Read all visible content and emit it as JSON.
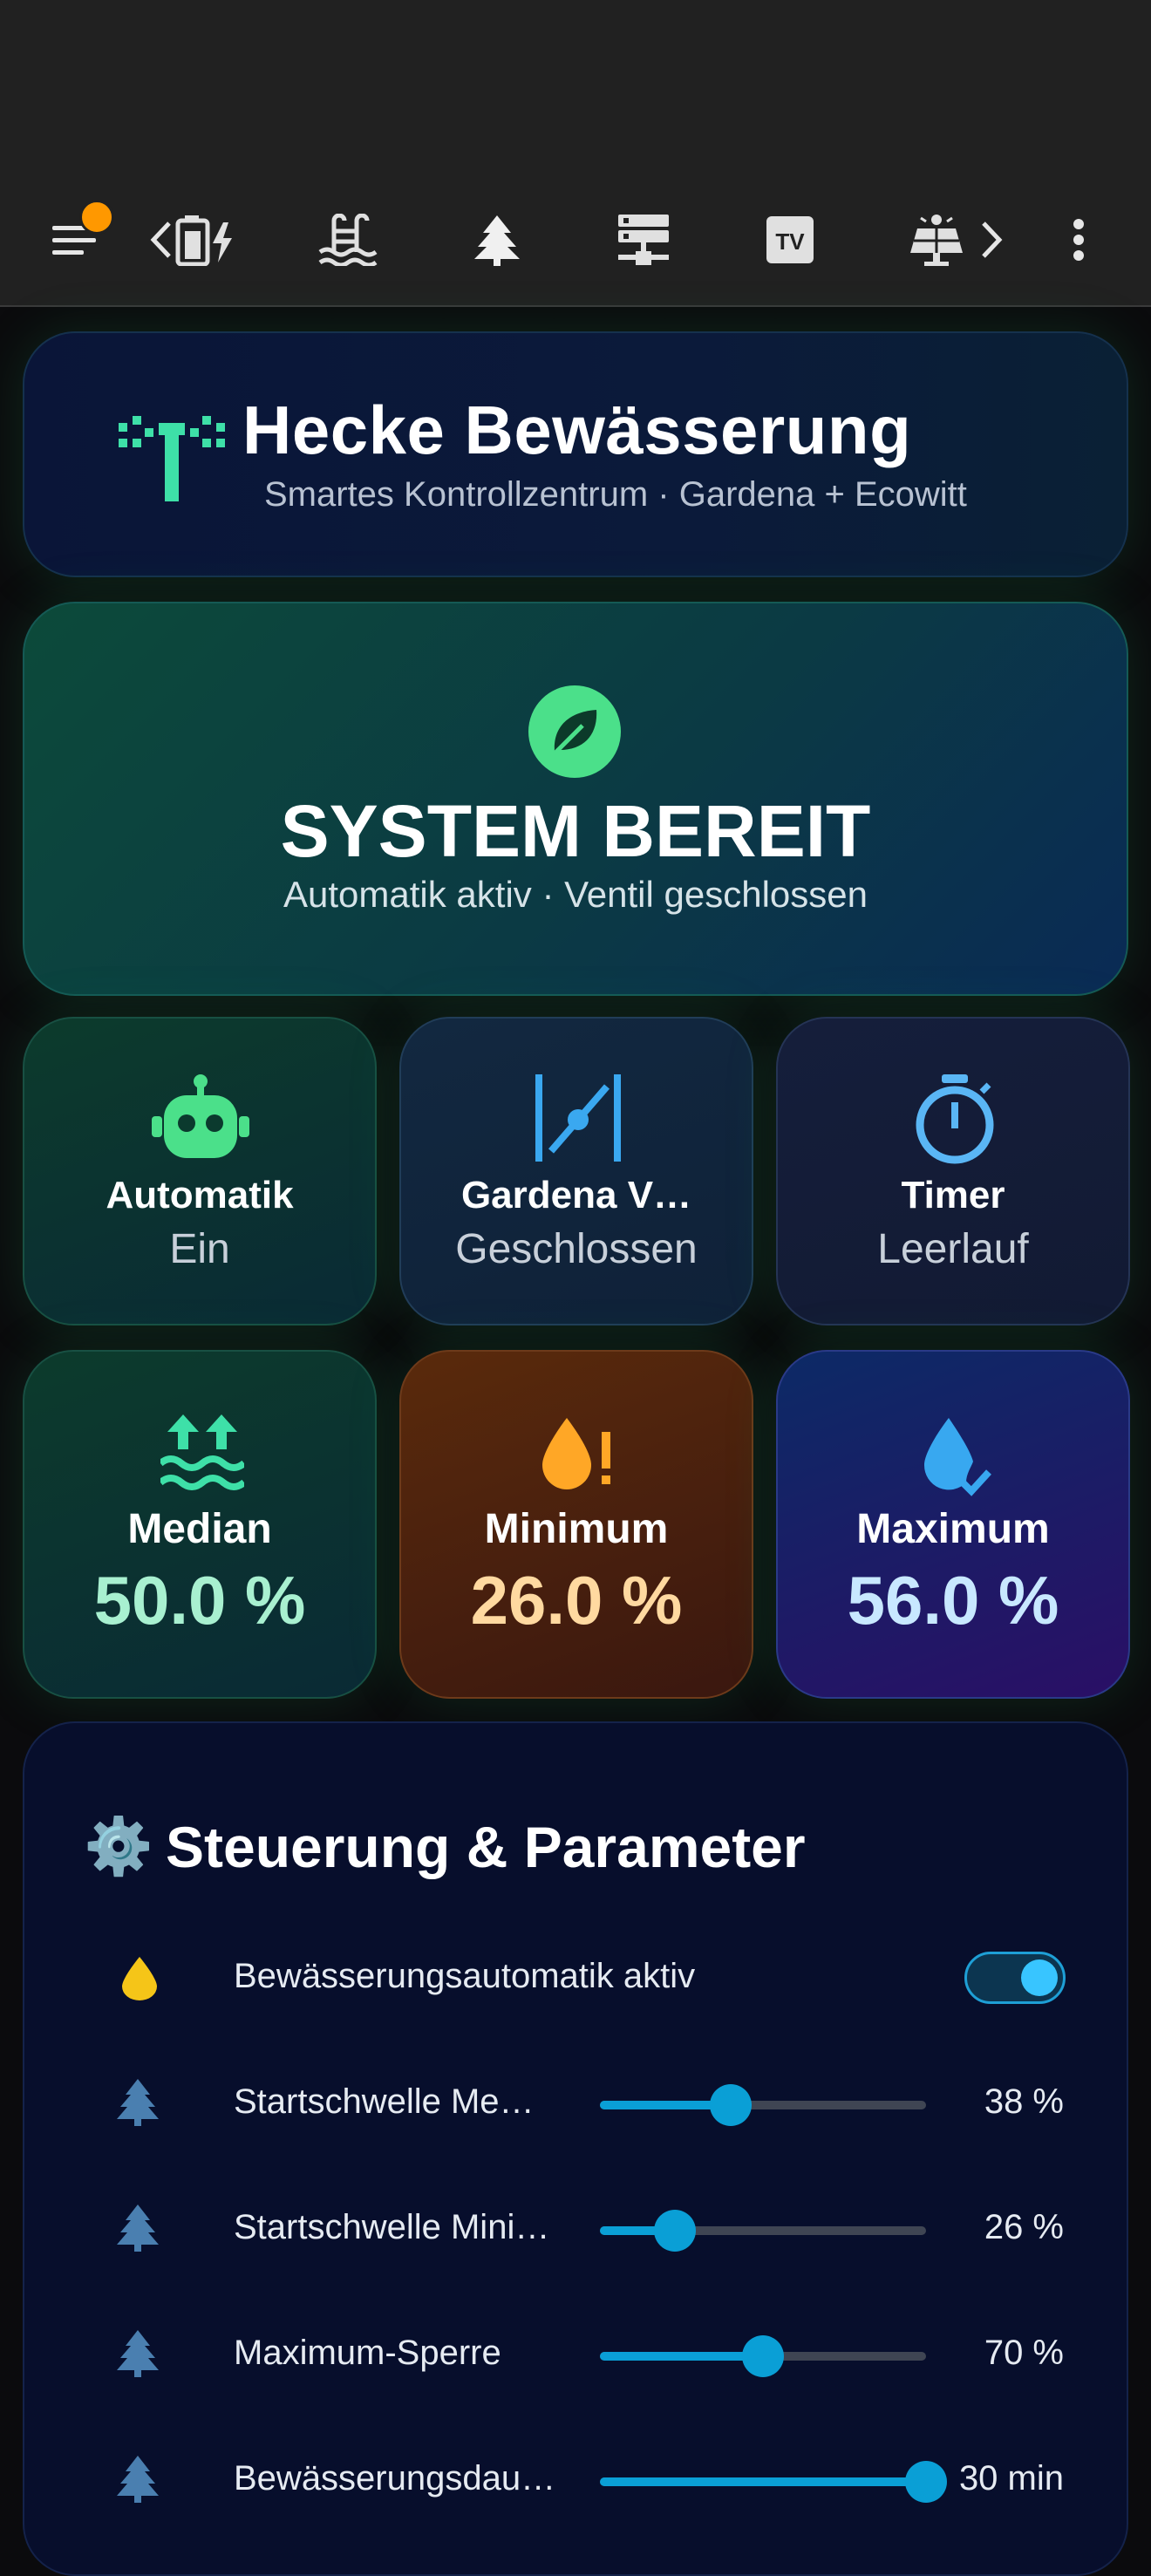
{
  "toolbar": {
    "tabs": [
      {
        "icon": "battery-charging-icon"
      },
      {
        "icon": "pool-icon"
      },
      {
        "icon": "pine-tree-icon",
        "active": true
      },
      {
        "icon": "server-icon"
      },
      {
        "icon": "tv-icon",
        "label": "TV"
      },
      {
        "icon": "solar-panel-icon"
      }
    ]
  },
  "header": {
    "title": "Hecke Bewässerung",
    "subtitle": "Smartes Kontrollzentrum · Gardena + Ecowitt",
    "icon": "sprinkler-icon"
  },
  "status": {
    "title": "SYSTEM BEREIT",
    "subtitle": "Automatik aktiv · Ventil geschlossen",
    "icon": "leaf-icon"
  },
  "tiles": {
    "automatik": {
      "label": "Automatik",
      "value": "Ein",
      "icon": "robot-icon"
    },
    "valve": {
      "label": "Gardena V…",
      "value": "Geschlossen",
      "icon": "valve-icon"
    },
    "timer": {
      "label": "Timer",
      "value": "Leerlauf",
      "icon": "timer-icon"
    },
    "median": {
      "label": "Median",
      "value": "50.0 %",
      "icon": "water-level-icon"
    },
    "minimum": {
      "label": "Minimum",
      "value": "26.0 %",
      "icon": "water-alert-icon"
    },
    "maximum": {
      "label": "Maximum",
      "value": "56.0 %",
      "icon": "water-check-icon"
    }
  },
  "params": {
    "title_emoji": "⚙️",
    "title": "Steuerung & Parameter",
    "rows": [
      {
        "label": "Bewässerungsautomatik aktiv",
        "icon": "water-drop-icon",
        "type": "toggle",
        "on": true
      },
      {
        "label": "Startschwelle Me…",
        "icon": "pine-tree-icon",
        "type": "slider",
        "value": "38 %",
        "fraction": 0.4
      },
      {
        "label": "Startschwelle Mini…",
        "icon": "pine-tree-icon",
        "type": "slider",
        "value": "26 %",
        "fraction": 0.23
      },
      {
        "label": "Maximum-Sperre",
        "icon": "pine-tree-icon",
        "type": "slider",
        "value": "70 %",
        "fraction": 0.5
      },
      {
        "label": "Bewässerungsdau…",
        "icon": "pine-tree-icon",
        "type": "slider",
        "value": "30 min",
        "fraction": 1.0
      }
    ]
  },
  "colors": {
    "accent_green": "#4be08a",
    "accent_blue": "#38a8f0",
    "accent_orange": "#ffa726",
    "median_value": "#a8f0d0",
    "minimum_value": "#ffd9a0",
    "maximum_value": "#c8e8ff"
  }
}
